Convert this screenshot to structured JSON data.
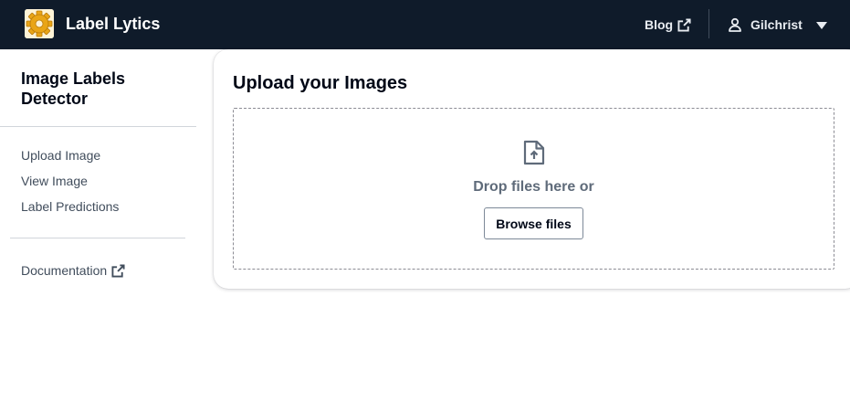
{
  "header": {
    "brand": "Label Lytics",
    "logo_icon": "gear-logo-icon",
    "blog_label": "Blog",
    "username": "Gilchrist"
  },
  "sidenav": {
    "title": "Image Labels Detector",
    "items": [
      {
        "label": "Upload Image"
      },
      {
        "label": "View Image"
      },
      {
        "label": "Label Predictions"
      }
    ],
    "documentation_label": "Documentation"
  },
  "main": {
    "title": "Upload your Images",
    "dropzone": {
      "text": "Drop files here or",
      "browse_label": "Browse files"
    }
  },
  "colors": {
    "topbar_bg": "#0f1b2a",
    "logo_gold": "#f0b429"
  }
}
